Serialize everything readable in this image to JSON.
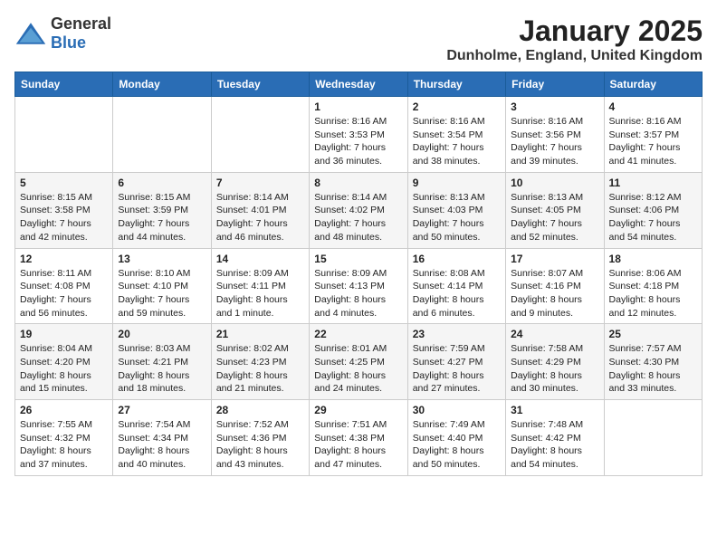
{
  "header": {
    "logo_general": "General",
    "logo_blue": "Blue",
    "month_title": "January 2025",
    "location": "Dunholme, England, United Kingdom"
  },
  "days_of_week": [
    "Sunday",
    "Monday",
    "Tuesday",
    "Wednesday",
    "Thursday",
    "Friday",
    "Saturday"
  ],
  "weeks": [
    [
      {
        "day": "",
        "info": ""
      },
      {
        "day": "",
        "info": ""
      },
      {
        "day": "",
        "info": ""
      },
      {
        "day": "1",
        "info": "Sunrise: 8:16 AM\nSunset: 3:53 PM\nDaylight: 7 hours\nand 36 minutes."
      },
      {
        "day": "2",
        "info": "Sunrise: 8:16 AM\nSunset: 3:54 PM\nDaylight: 7 hours\nand 38 minutes."
      },
      {
        "day": "3",
        "info": "Sunrise: 8:16 AM\nSunset: 3:56 PM\nDaylight: 7 hours\nand 39 minutes."
      },
      {
        "day": "4",
        "info": "Sunrise: 8:16 AM\nSunset: 3:57 PM\nDaylight: 7 hours\nand 41 minutes."
      }
    ],
    [
      {
        "day": "5",
        "info": "Sunrise: 8:15 AM\nSunset: 3:58 PM\nDaylight: 7 hours\nand 42 minutes."
      },
      {
        "day": "6",
        "info": "Sunrise: 8:15 AM\nSunset: 3:59 PM\nDaylight: 7 hours\nand 44 minutes."
      },
      {
        "day": "7",
        "info": "Sunrise: 8:14 AM\nSunset: 4:01 PM\nDaylight: 7 hours\nand 46 minutes."
      },
      {
        "day": "8",
        "info": "Sunrise: 8:14 AM\nSunset: 4:02 PM\nDaylight: 7 hours\nand 48 minutes."
      },
      {
        "day": "9",
        "info": "Sunrise: 8:13 AM\nSunset: 4:03 PM\nDaylight: 7 hours\nand 50 minutes."
      },
      {
        "day": "10",
        "info": "Sunrise: 8:13 AM\nSunset: 4:05 PM\nDaylight: 7 hours\nand 52 minutes."
      },
      {
        "day": "11",
        "info": "Sunrise: 8:12 AM\nSunset: 4:06 PM\nDaylight: 7 hours\nand 54 minutes."
      }
    ],
    [
      {
        "day": "12",
        "info": "Sunrise: 8:11 AM\nSunset: 4:08 PM\nDaylight: 7 hours\nand 56 minutes."
      },
      {
        "day": "13",
        "info": "Sunrise: 8:10 AM\nSunset: 4:10 PM\nDaylight: 7 hours\nand 59 minutes."
      },
      {
        "day": "14",
        "info": "Sunrise: 8:09 AM\nSunset: 4:11 PM\nDaylight: 8 hours\nand 1 minute."
      },
      {
        "day": "15",
        "info": "Sunrise: 8:09 AM\nSunset: 4:13 PM\nDaylight: 8 hours\nand 4 minutes."
      },
      {
        "day": "16",
        "info": "Sunrise: 8:08 AM\nSunset: 4:14 PM\nDaylight: 8 hours\nand 6 minutes."
      },
      {
        "day": "17",
        "info": "Sunrise: 8:07 AM\nSunset: 4:16 PM\nDaylight: 8 hours\nand 9 minutes."
      },
      {
        "day": "18",
        "info": "Sunrise: 8:06 AM\nSunset: 4:18 PM\nDaylight: 8 hours\nand 12 minutes."
      }
    ],
    [
      {
        "day": "19",
        "info": "Sunrise: 8:04 AM\nSunset: 4:20 PM\nDaylight: 8 hours\nand 15 minutes."
      },
      {
        "day": "20",
        "info": "Sunrise: 8:03 AM\nSunset: 4:21 PM\nDaylight: 8 hours\nand 18 minutes."
      },
      {
        "day": "21",
        "info": "Sunrise: 8:02 AM\nSunset: 4:23 PM\nDaylight: 8 hours\nand 21 minutes."
      },
      {
        "day": "22",
        "info": "Sunrise: 8:01 AM\nSunset: 4:25 PM\nDaylight: 8 hours\nand 24 minutes."
      },
      {
        "day": "23",
        "info": "Sunrise: 7:59 AM\nSunset: 4:27 PM\nDaylight: 8 hours\nand 27 minutes."
      },
      {
        "day": "24",
        "info": "Sunrise: 7:58 AM\nSunset: 4:29 PM\nDaylight: 8 hours\nand 30 minutes."
      },
      {
        "day": "25",
        "info": "Sunrise: 7:57 AM\nSunset: 4:30 PM\nDaylight: 8 hours\nand 33 minutes."
      }
    ],
    [
      {
        "day": "26",
        "info": "Sunrise: 7:55 AM\nSunset: 4:32 PM\nDaylight: 8 hours\nand 37 minutes."
      },
      {
        "day": "27",
        "info": "Sunrise: 7:54 AM\nSunset: 4:34 PM\nDaylight: 8 hours\nand 40 minutes."
      },
      {
        "day": "28",
        "info": "Sunrise: 7:52 AM\nSunset: 4:36 PM\nDaylight: 8 hours\nand 43 minutes."
      },
      {
        "day": "29",
        "info": "Sunrise: 7:51 AM\nSunset: 4:38 PM\nDaylight: 8 hours\nand 47 minutes."
      },
      {
        "day": "30",
        "info": "Sunrise: 7:49 AM\nSunset: 4:40 PM\nDaylight: 8 hours\nand 50 minutes."
      },
      {
        "day": "31",
        "info": "Sunrise: 7:48 AM\nSunset: 4:42 PM\nDaylight: 8 hours\nand 54 minutes."
      },
      {
        "day": "",
        "info": ""
      }
    ]
  ]
}
